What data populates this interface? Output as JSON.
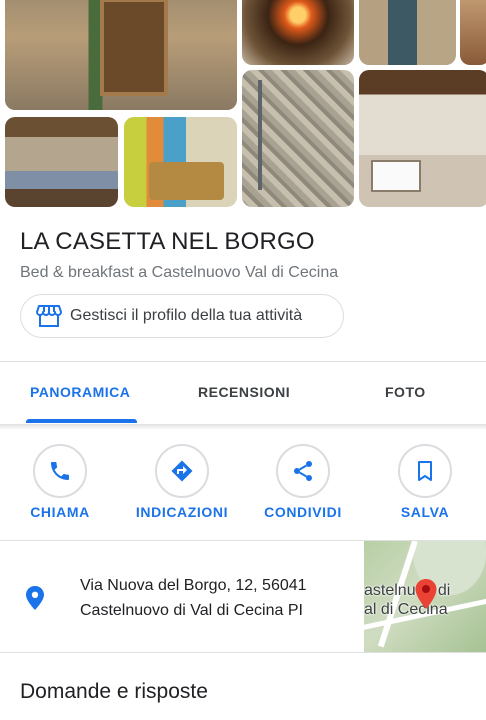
{
  "business": {
    "name": "LA CASETTA NEL BORGO",
    "category": "Bed & breakfast a Castelnuovo Val di Cecina",
    "manage_label": "Gestisci il profilo della tua attività"
  },
  "tabs": [
    {
      "label": "PANORAMICA",
      "active": true
    },
    {
      "label": "RECENSIONI",
      "active": false
    },
    {
      "label": "FOTO",
      "active": false
    }
  ],
  "actions": [
    {
      "label": "CHIAMA",
      "icon": "phone-icon"
    },
    {
      "label": "INDICAZIONI",
      "icon": "directions-icon"
    },
    {
      "label": "CONDIVIDI",
      "icon": "share-icon"
    },
    {
      "label": "SALVA",
      "icon": "bookmark-icon"
    }
  ],
  "address": {
    "line1": "Via Nuova del Borgo, 12, 56041",
    "line2": "Castelnuovo di Val di Cecina PI"
  },
  "map": {
    "label": "astelnu  o di\nal di Cecina"
  },
  "sections": {
    "qa_title": "Domande e risposte"
  },
  "colors": {
    "accent": "#1a73e8",
    "pin_red": "#ea4335",
    "text_primary": "#202124",
    "text_secondary": "#70757a"
  }
}
